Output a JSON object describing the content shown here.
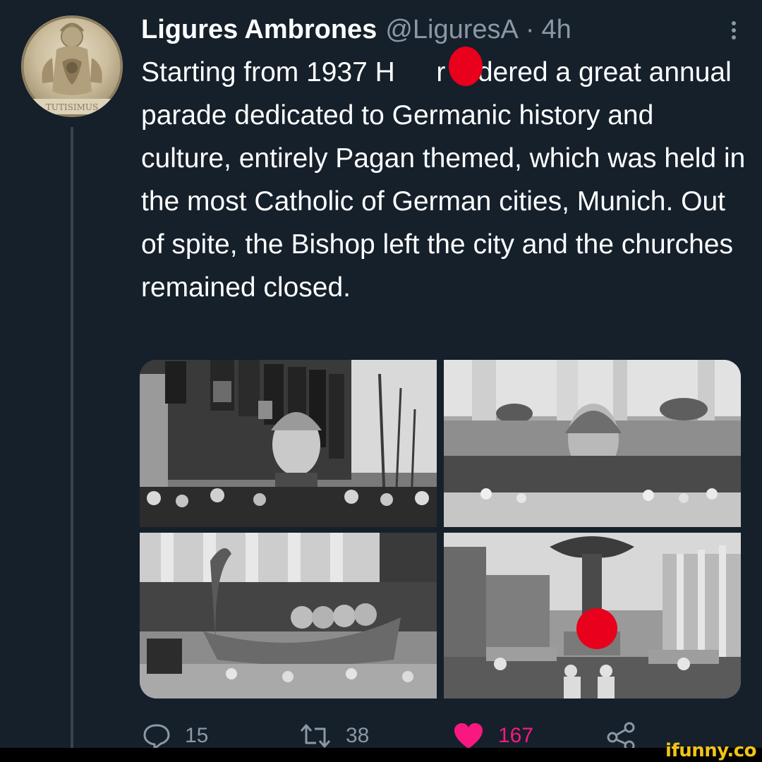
{
  "tweet": {
    "display_name": "Ligures Ambrones",
    "handle": "@LiguresA",
    "separator": "·",
    "time": "4h",
    "text": "Starting from 1937 H  r ordered a great annual parade dedicated to Germanic history and culture, entirely Pagan themed, which was held in the most Catholic of German cities, Munich. Out of spite, the Bishop left the city and the churches remained closed.",
    "avatar_icon": "statue-medallion-avatar",
    "avatar_text": "TUTISIMUS"
  },
  "actions": {
    "reply_count": "15",
    "retweet_count": "38",
    "like_count": "167",
    "reply_icon": "speech-bubble-icon",
    "retweet_icon": "retweet-arrows-icon",
    "like_icon": "heart-icon",
    "share_icon": "share-nodes-icon"
  },
  "media": {
    "photos": [
      "parade-banners-helmet-head",
      "stadium-athena-statue-float",
      "viking-ship-float",
      "eagle-monument-procession"
    ]
  },
  "watermark": {
    "text": "ifunny.co"
  },
  "colors": {
    "background": "#15202b",
    "primary_text": "#ffffff",
    "secondary_text": "#8b98a5",
    "like_pink": "#f91880",
    "censor_red": "#e8001c",
    "thread_line": "#38444d",
    "watermark_yellow": "#f2c318"
  }
}
